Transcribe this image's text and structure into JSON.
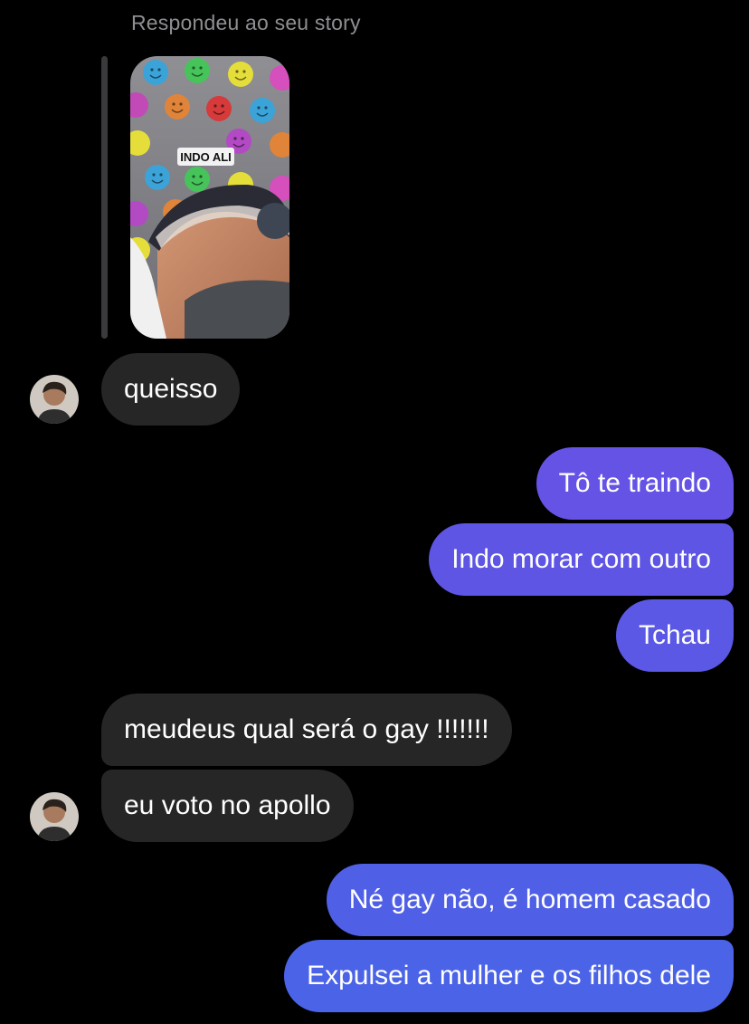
{
  "reply_header": "Respondeu ao seu story",
  "story": {
    "sticker_text": "INDO ALI"
  },
  "messages": [
    {
      "side": "incoming",
      "text": "queisso"
    },
    {
      "side": "outgoing",
      "text": "Tô te traindo"
    },
    {
      "side": "outgoing",
      "text": "Indo morar com outro"
    },
    {
      "side": "outgoing",
      "text": "Tchau"
    },
    {
      "side": "incoming",
      "text": "meudeus qual será o gay !!!!!!!"
    },
    {
      "side": "incoming",
      "text": "eu voto no apollo"
    },
    {
      "side": "outgoing",
      "text": "Né gay não, é homem casado"
    },
    {
      "side": "outgoing",
      "text": "Expulsei a mulher e os filhos dele"
    }
  ],
  "colors": {
    "background": "#000000",
    "incoming_bubble": "#262626",
    "outgoing_gradient": [
      "#6a4fe0",
      "#4f5ee6"
    ],
    "muted_text": "#8e8e93"
  },
  "icons": {
    "avatar": "contact-avatar",
    "story": "story-thumbnail"
  }
}
